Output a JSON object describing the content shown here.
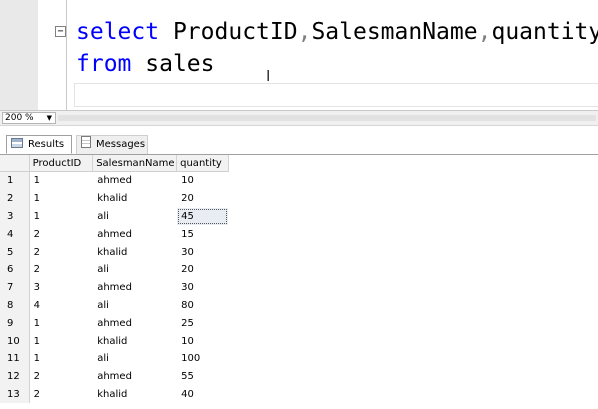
{
  "editor": {
    "collapse_symbol": "−",
    "line1": {
      "keyword": "select",
      "columns": [
        "ProductID",
        "SalesmanName",
        "quantity"
      ],
      "comma": ","
    },
    "line2": {
      "keyword": "from",
      "table": "sales"
    },
    "cursor_glyph": "I"
  },
  "zoom": {
    "value": "200 %",
    "arrow": "▼"
  },
  "tabs": {
    "results": "Results",
    "messages": "Messages"
  },
  "grid": {
    "columns": [
      "ProductID",
      "SalesmanName",
      "quantity"
    ],
    "selected_cell": {
      "row": 3,
      "column": "quantity"
    },
    "rows": [
      {
        "n": "1",
        "cells": [
          "1",
          "ahmed",
          "10"
        ]
      },
      {
        "n": "2",
        "cells": [
          "1",
          "khalid",
          "20"
        ]
      },
      {
        "n": "3",
        "cells": [
          "1",
          "ali",
          "45"
        ]
      },
      {
        "n": "4",
        "cells": [
          "2",
          "ahmed",
          "15"
        ]
      },
      {
        "n": "5",
        "cells": [
          "2",
          "khalid",
          "30"
        ]
      },
      {
        "n": "6",
        "cells": [
          "2",
          "ali",
          "20"
        ]
      },
      {
        "n": "7",
        "cells": [
          "3",
          "ahmed",
          "30"
        ]
      },
      {
        "n": "8",
        "cells": [
          "4",
          "ali",
          "80"
        ]
      },
      {
        "n": "9",
        "cells": [
          "1",
          "ahmed",
          "25"
        ]
      },
      {
        "n": "10",
        "cells": [
          "1",
          "khalid",
          "10"
        ]
      },
      {
        "n": "11",
        "cells": [
          "1",
          "ali",
          "100"
        ]
      },
      {
        "n": "12",
        "cells": [
          "2",
          "ahmed",
          "55"
        ]
      },
      {
        "n": "13",
        "cells": [
          "2",
          "khalid",
          "40"
        ]
      }
    ]
  }
}
